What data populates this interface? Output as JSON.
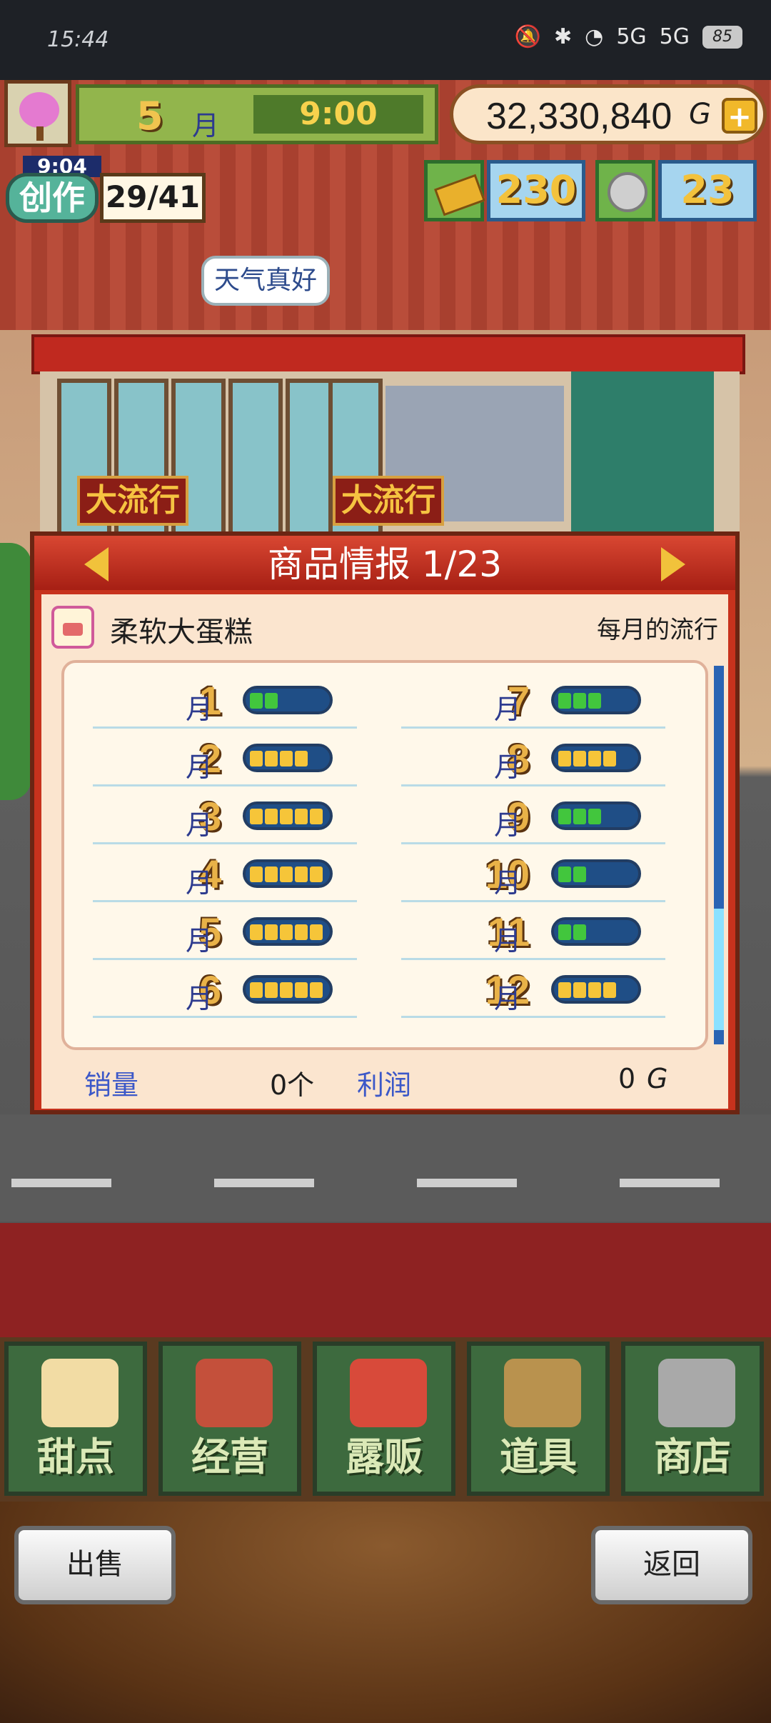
{
  "status_bar": {
    "time": "15:44",
    "signal_1": "5G",
    "signal_2": "5G",
    "battery": "85"
  },
  "hud": {
    "month_num": "5",
    "month_unit": "月",
    "clock": "9:00",
    "money": "32,330,840",
    "money_unit": "G",
    "add_label": "+",
    "create_timer": "9:04",
    "create_label": "创作",
    "create_count": "29/41",
    "gold_bars": "230",
    "coins": "23"
  },
  "scene": {
    "speech_bubble": "天气真好",
    "trend_sign_1": "大流行",
    "trend_sign_2": "大流行"
  },
  "panel": {
    "title": "商品情报 1/23",
    "product_name": "柔软大蛋糕",
    "trend_heading": "每月的流行",
    "month_unit": "月",
    "sales_label": "销量",
    "sales_value": "0个",
    "profit_label": "利润",
    "profit_value": "0",
    "profit_unit": "G"
  },
  "chart_data": {
    "type": "table",
    "title": "每月的流行",
    "categories": [
      "1",
      "2",
      "3",
      "4",
      "5",
      "6",
      "7",
      "8",
      "9",
      "10",
      "11",
      "12"
    ],
    "values": [
      2,
      4,
      5,
      5,
      5,
      5,
      3,
      4,
      3,
      2,
      2,
      4
    ],
    "max_value": 5,
    "colors": {
      "low": "#42c63d",
      "high": "#f6c539"
    }
  },
  "nav": [
    {
      "label": "甜点",
      "icon": "cake-icon"
    },
    {
      "label": "经营",
      "icon": "shop-icon"
    },
    {
      "label": "露贩",
      "icon": "food-truck-icon"
    },
    {
      "label": "道具",
      "icon": "tools-bag-icon"
    },
    {
      "label": "商店",
      "icon": "shopping-cart-icon"
    }
  ],
  "footer": {
    "sell_label": "出售",
    "back_label": "返回"
  }
}
